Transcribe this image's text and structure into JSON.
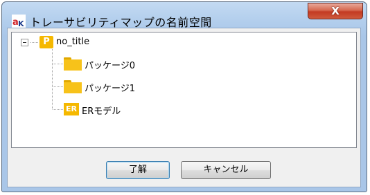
{
  "window": {
    "title": "トレーサビリティマップの名前空間",
    "close_label": "X"
  },
  "tree": {
    "root": {
      "label": "no_title",
      "icon_letter": "P",
      "expander": "−"
    },
    "children": [
      {
        "label": "パッケージ0",
        "icon": "folder-icon"
      },
      {
        "label": "パッケージ1",
        "icon": "folder-icon"
      },
      {
        "label": "ERモデル",
        "icon": "er-model-icon",
        "icon_letter": "ER"
      }
    ]
  },
  "buttons": {
    "ok_label": "了解",
    "cancel_label": "キャンセル"
  },
  "colors": {
    "package_icon": "#f5b800",
    "folder_icon": "#f7c21a",
    "close_button": "#c33a22"
  }
}
